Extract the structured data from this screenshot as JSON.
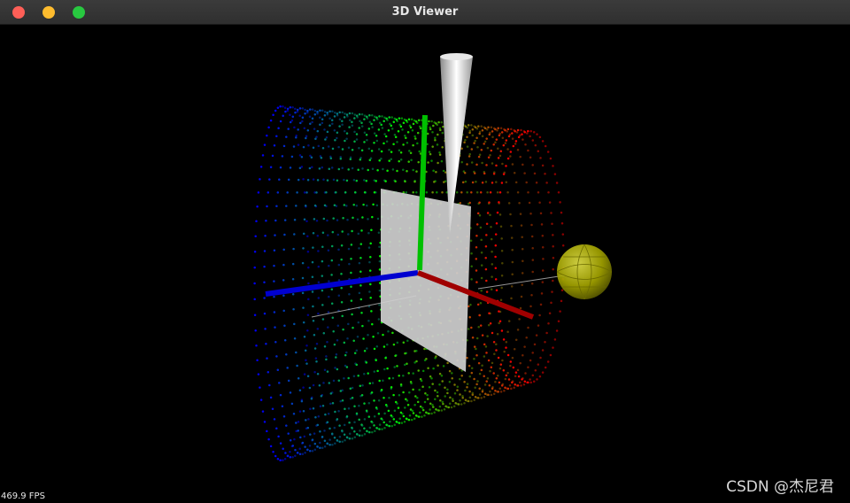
{
  "window": {
    "title": "3D Viewer"
  },
  "viewport": {
    "fps_text": "469.9 FPS",
    "watermark": "CSDN @杰尼君",
    "background_color": "#000000",
    "point_cloud_gradient": [
      "#0000ff",
      "#00ff00",
      "#ff0000"
    ],
    "axis_colors": {
      "x": "#a00000",
      "y": "#00c000",
      "z": "#0000d0"
    },
    "plane_color": "#cfcfcf",
    "cone_color": "#ffffff",
    "sphere_color": "#b5b500"
  }
}
